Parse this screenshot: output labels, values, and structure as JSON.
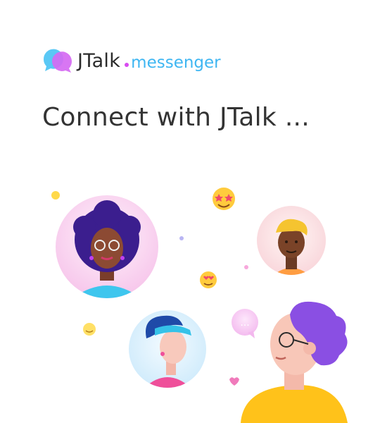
{
  "brand": {
    "name": "JTalk",
    "suffix": "messenger"
  },
  "headline": "Connect with JTalk ...",
  "chat_bubble_text": "...",
  "colors": {
    "brand_pink": "#e55cf0",
    "brand_blue": "#3eb6f2",
    "text_dark": "#333333",
    "accent_yellow": "#ffc21a",
    "accent_purple": "#8a4fe3"
  }
}
